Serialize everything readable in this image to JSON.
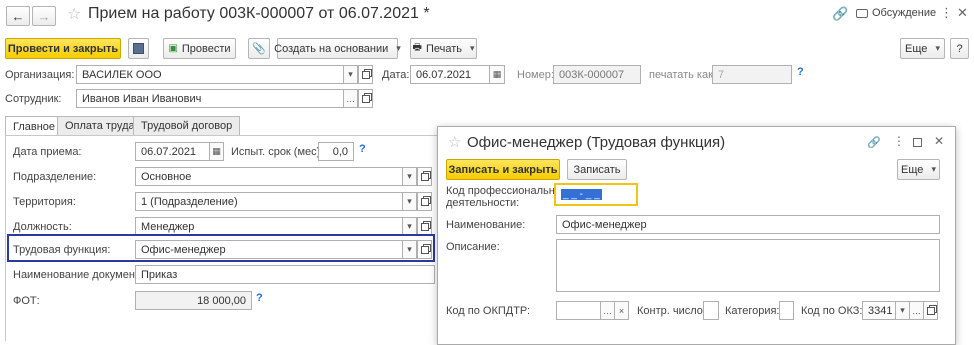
{
  "header": {
    "title": "Прием на работу 003К-000007 от 06.07.2021 *",
    "discussion": "Обсуждение"
  },
  "toolbar": {
    "post_close": "Провести и закрыть",
    "post": "Провести",
    "create_based": "Создать на основании",
    "print": "Печать",
    "more": "Еще"
  },
  "doc": {
    "org_label": "Организация:",
    "org_value": "ВАСИЛЕК ООО",
    "date_label": "Дата:",
    "date_value": "06.07.2021",
    "number_label": "Номер:",
    "number_value": "003К-000007",
    "print_as_label": "печатать как:",
    "print_as_value": "7",
    "employee_label": "Сотрудник:",
    "employee_value": "Иванов Иван Иванович"
  },
  "tabs": [
    "Главное",
    "Оплата труда",
    "Трудовой договор"
  ],
  "main": {
    "hire_date_label": "Дата приема:",
    "hire_date_value": "06.07.2021",
    "probation_label": "Испыт. срок (мес):",
    "probation_value": "0,0",
    "dept_label": "Подразделение:",
    "dept_value": "Основное",
    "territory_label": "Территория:",
    "territory_value": "1 (Подразделение)",
    "position_label": "Должность:",
    "position_value": "Менеджер",
    "labor_func_label": "Трудовая функция:",
    "labor_func_value": "Офис-менеджер",
    "doc_name_label": "Наименование документа:",
    "doc_name_value": "Приказ",
    "fot_label": "ФОТ:",
    "fot_value": "18 000,00"
  },
  "dialog": {
    "title": "Офис-менеджер (Трудовая функция)",
    "save_close": "Записать и закрыть",
    "save": "Записать",
    "more": "Еще",
    "prof_code_label_1": "Код профессиональной",
    "prof_code_label_2": "деятельности:",
    "prof_code_value": "_ _ - _ _",
    "name_label": "Наименование:",
    "name_value": "Офис-менеджер",
    "desc_label": "Описание:",
    "okpdtr_label": "Код по ОКПДТР:",
    "control_label": "Контр. число:",
    "category_label": "Категория:",
    "okz_label": "Код по ОКЗ:",
    "okz_value": "3341"
  },
  "colors": {
    "primary_button": "#f5cd00",
    "highlight_border": "#2b3a9c",
    "focus_border": "#f0c419",
    "help": "#1f6fd1"
  }
}
